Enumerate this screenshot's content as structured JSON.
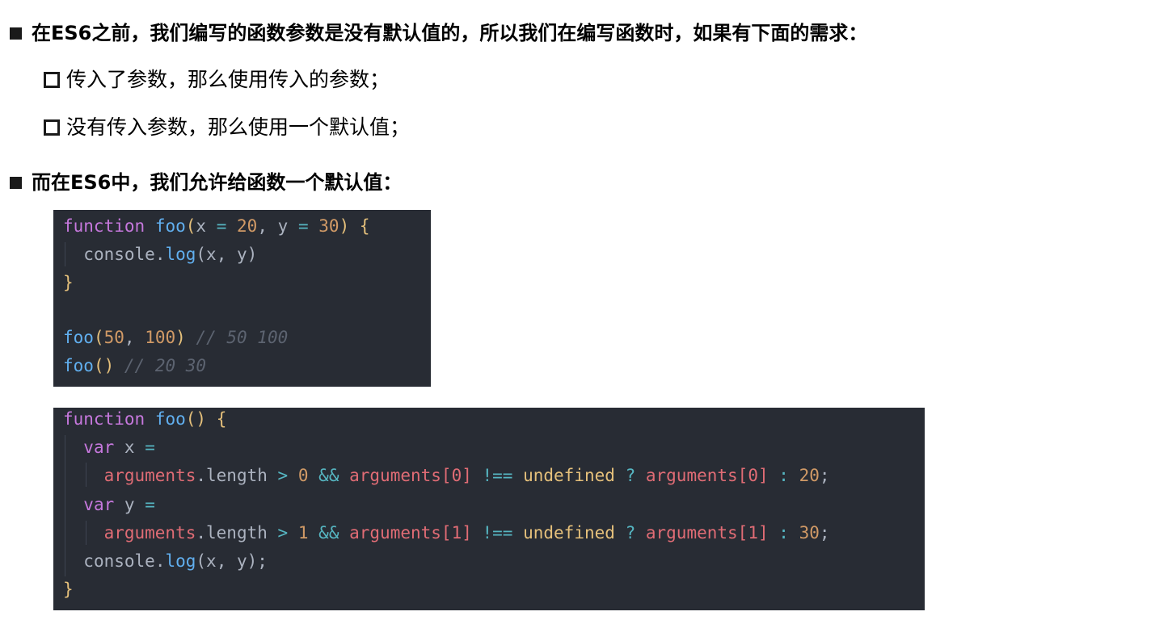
{
  "bullets": {
    "intro": "在ES6之前，我们编写的函数参数是没有默认值的，所以我们在编写函数时，如果有下面的需求：",
    "sub1": "传入了参数，那么使用传入的参数；",
    "sub2": "没有传入参数，那么使用一个默认值；",
    "es6": "而在ES6中，我们允许给函数一个默认值："
  },
  "code1": {
    "line1": {
      "kw": "function",
      "name": "foo",
      "p1": "(",
      "x": "x",
      "eq1": "=",
      "v1": "20",
      "comma": ",",
      "y": "y",
      "eq2": "=",
      "v2": "30",
      "p2": ")",
      "brace": "{"
    },
    "line2": {
      "obj": "console",
      "dot": ".",
      "method": "log",
      "args": "(x, y)"
    },
    "line3": {
      "brace": "}"
    },
    "line5": {
      "name": "foo",
      "open": "(",
      "a1": "50",
      "comma": ",",
      "a2": "100",
      "close": ")",
      "comment": "// 50 100"
    },
    "line6": {
      "name": "foo",
      "parens": "()",
      "comment": "// 20 30"
    }
  },
  "code2": {
    "line1": {
      "kw": "function",
      "name": "foo",
      "parens": "()",
      "brace": "{"
    },
    "line2": {
      "kw": "var",
      "name": "x",
      "eq": "="
    },
    "line3": {
      "a1": "arguments",
      "len": ".length",
      "gt": ">",
      "n": "0",
      "and": "&&",
      "a2": "arguments",
      "idx": "[0]",
      "neq": "!==",
      "und": "undefined",
      "q": "?",
      "a3": "arguments",
      "idx2": "[0]",
      "colon": ":",
      "def": "20",
      "semi": ";"
    },
    "line4": {
      "kw": "var",
      "name": "y",
      "eq": "="
    },
    "line5": {
      "a1": "arguments",
      "len": ".length",
      "gt": ">",
      "n": "1",
      "and": "&&",
      "a2": "arguments",
      "idx": "[1]",
      "neq": "!==",
      "und": "undefined",
      "q": "?",
      "a3": "arguments",
      "idx2": "[1]",
      "colon": ":",
      "def": "30",
      "semi": ";"
    },
    "line6": {
      "obj": "console",
      "dot": ".",
      "method": "log",
      "args": "(x, y);"
    },
    "line7": {
      "brace": "}"
    }
  },
  "icons": {
    "bullet_filled": "filled-square-bullet-icon",
    "bullet_hollow": "hollow-square-bullet-icon"
  },
  "colors": {
    "code_bg": "#282c34",
    "keyword": "#c678dd",
    "function": "#61afef",
    "number": "#d19a66",
    "operator": "#56b6c2",
    "brace": "#e5c07b",
    "comment": "#5c6370",
    "variable": "#e06c75"
  }
}
